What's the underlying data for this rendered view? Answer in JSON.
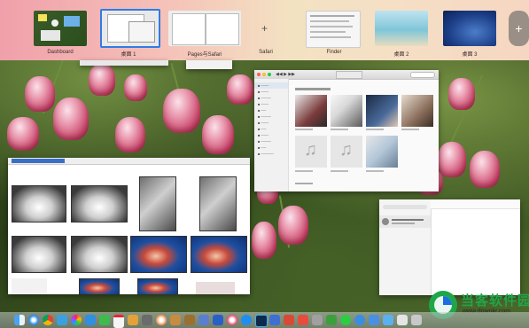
{
  "mission_control": {
    "spaces": [
      {
        "label": "Dashboard"
      },
      {
        "label": "桌面 1"
      },
      {
        "label": "Pages与Safari"
      },
      {
        "label": "Safari"
      },
      {
        "label": "Finder"
      },
      {
        "label": "桌面 2"
      },
      {
        "label": "桌面 3"
      }
    ],
    "add_symbol": "+"
  },
  "watermark": {
    "brand": "当客软件园",
    "url": "www.downkr.com"
  },
  "colors": {
    "accent_blue": "#1d6fe0",
    "dock_glass": "#b8bcc2",
    "watermark_green": "#1fa64a"
  }
}
